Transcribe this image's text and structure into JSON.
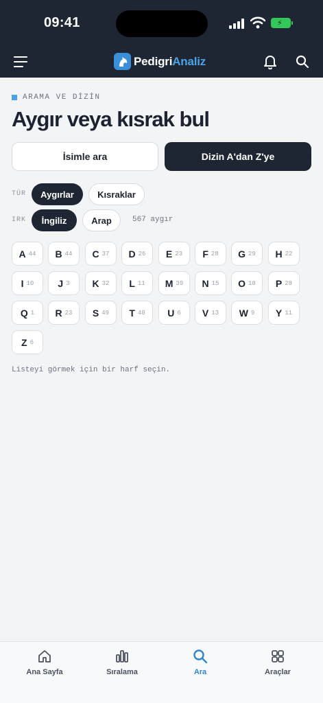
{
  "status_bar": {
    "time": "09:41"
  },
  "app": {
    "brand_primary": "Pedigri",
    "brand_accent": "Analiz",
    "accent_color": "#4aa3e6",
    "dark_color": "#1f2633"
  },
  "header": {
    "icons": [
      "menu-icon",
      "bell-icon",
      "search-icon"
    ]
  },
  "page": {
    "section_label": "ARAMA VE DİZİN",
    "title": "Aygır veya kısrak bul"
  },
  "tabs": {
    "by_name": "İsimle ara",
    "index": "Dizin A'dan Z'ye",
    "active": "index"
  },
  "filters": {
    "type_label": "TÜR",
    "type_options": [
      "Aygırlar",
      "Kısraklar"
    ],
    "type_selected": "Aygırlar",
    "breed_label": "IRK",
    "breed_options": [
      "İngiliz",
      "Arap"
    ],
    "breed_selected": "İngiliz",
    "count_text": "567 aygır"
  },
  "letters": [
    {
      "l": "A",
      "n": "44"
    },
    {
      "l": "B",
      "n": "44"
    },
    {
      "l": "C",
      "n": "37"
    },
    {
      "l": "D",
      "n": "26"
    },
    {
      "l": "E",
      "n": "23"
    },
    {
      "l": "F",
      "n": "28"
    },
    {
      "l": "G",
      "n": "29"
    },
    {
      "l": "H",
      "n": "22"
    },
    {
      "l": "I",
      "n": "10"
    },
    {
      "l": "J",
      "n": "3"
    },
    {
      "l": "K",
      "n": "32"
    },
    {
      "l": "L",
      "n": "11"
    },
    {
      "l": "M",
      "n": "39"
    },
    {
      "l": "N",
      "n": "15"
    },
    {
      "l": "O",
      "n": "18"
    },
    {
      "l": "P",
      "n": "28"
    },
    {
      "l": "Q",
      "n": "1"
    },
    {
      "l": "R",
      "n": "23"
    },
    {
      "l": "S",
      "n": "49"
    },
    {
      "l": "T",
      "n": "40"
    },
    {
      "l": "U",
      "n": "6"
    },
    {
      "l": "V",
      "n": "13"
    },
    {
      "l": "W",
      "n": "9"
    },
    {
      "l": "Y",
      "n": "11"
    },
    {
      "l": "Z",
      "n": "6"
    }
  ],
  "hint": "Listeyi görmek için bir harf seçin.",
  "bottom_nav": [
    {
      "label": "Ana Sayfa",
      "icon": "home-icon"
    },
    {
      "label": "Sıralama",
      "icon": "chart-icon"
    },
    {
      "label": "Ara",
      "icon": "search-icon",
      "active": true
    },
    {
      "label": "Araçlar",
      "icon": "grid-icon"
    }
  ]
}
